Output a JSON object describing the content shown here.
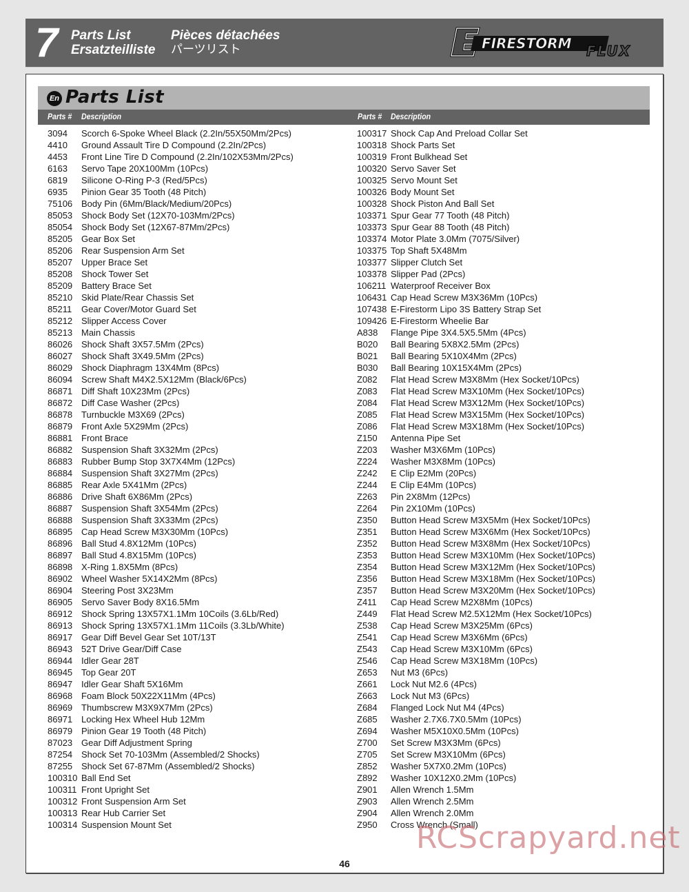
{
  "header": {
    "chapter_number": "7",
    "title_en": "Parts List",
    "title_fr": "Pièces détachées",
    "title_de": "Ersatzteilliste",
    "title_jp": "パーツリスト",
    "logo_text_main": "FIRESTORM",
    "logo_text_sub": "FLUX",
    "logo_letter": "E"
  },
  "section": {
    "language_badge": "En",
    "title": "Parts List"
  },
  "columns": {
    "parts_num": "Parts #",
    "description": "Description"
  },
  "parts_left": [
    {
      "num": "3094",
      "desc": "Scorch 6-Spoke Wheel Black (2.2In/55X50Mm/2Pcs)"
    },
    {
      "num": "4410",
      "desc": "Ground Assault Tire D Compound (2.2In/2Pcs)"
    },
    {
      "num": "4453",
      "desc": "Front Line Tire D Compound (2.2In/102X53Mm/2Pcs)"
    },
    {
      "num": "6163",
      "desc": "Servo Tape 20X100Mm (10Pcs)"
    },
    {
      "num": "6819",
      "desc": "Silicone O-Ring P-3 (Red/5Pcs)"
    },
    {
      "num": "6935",
      "desc": "Pinion Gear 35 Tooth (48 Pitch)"
    },
    {
      "num": "75106",
      "desc": "Body Pin (6Mm/Black/Medium/20Pcs)"
    },
    {
      "num": "85053",
      "desc": "Shock Body Set (12X70-103Mm/2Pcs)"
    },
    {
      "num": "85054",
      "desc": "Shock Body Set (12X67-87Mm/2Pcs)"
    },
    {
      "num": "85205",
      "desc": "Gear Box Set"
    },
    {
      "num": "85206",
      "desc": "Rear Suspension Arm Set"
    },
    {
      "num": "85207",
      "desc": "Upper Brace Set"
    },
    {
      "num": "85208",
      "desc": "Shock Tower Set"
    },
    {
      "num": "85209",
      "desc": "Battery Brace Set"
    },
    {
      "num": "85210",
      "desc": "Skid Plate/Rear Chassis Set"
    },
    {
      "num": "85211",
      "desc": "Gear Cover/Motor Guard Set"
    },
    {
      "num": "85212",
      "desc": "Slipper Access Cover"
    },
    {
      "num": "85213",
      "desc": "Main Chassis"
    },
    {
      "num": "86026",
      "desc": "Shock Shaft 3X57.5Mm (2Pcs)"
    },
    {
      "num": "86027",
      "desc": "Shock Shaft 3X49.5Mm (2Pcs)"
    },
    {
      "num": "86029",
      "desc": "Shock Diaphragm 13X4Mm (8Pcs)"
    },
    {
      "num": "86094",
      "desc": "Screw Shaft M4X2.5X12Mm (Black/6Pcs)"
    },
    {
      "num": "86871",
      "desc": "Diff Shaft 10X23Mm (2Pcs)"
    },
    {
      "num": "86872",
      "desc": "Diff Case Washer (2Pcs)"
    },
    {
      "num": "86878",
      "desc": "Turnbuckle M3X69 (2Pcs)"
    },
    {
      "num": "86879",
      "desc": "Front Axle 5X29Mm (2Pcs)"
    },
    {
      "num": "86881",
      "desc": "Front Brace"
    },
    {
      "num": "86882",
      "desc": "Suspension Shaft 3X32Mm (2Pcs)"
    },
    {
      "num": "86883",
      "desc": "Rubber Bump Stop 3X7X4Mm (12Pcs)"
    },
    {
      "num": "86884",
      "desc": "Suspension Shaft 3X27Mm (2Pcs)"
    },
    {
      "num": "86885",
      "desc": "Rear Axle 5X41Mm (2Pcs)"
    },
    {
      "num": "86886",
      "desc": "Drive Shaft 6X86Mm (2Pcs)"
    },
    {
      "num": "86887",
      "desc": "Suspension Shaft 3X54Mm (2Pcs)"
    },
    {
      "num": "86888",
      "desc": "Suspension Shaft 3X33Mm (2Pcs)"
    },
    {
      "num": "86895",
      "desc": "Cap Head Screw M3X30Mm (10Pcs)"
    },
    {
      "num": "86896",
      "desc": "Ball Stud 4.8X12Mm (10Pcs)"
    },
    {
      "num": "86897",
      "desc": "Ball Stud 4.8X15Mm (10Pcs)"
    },
    {
      "num": "86898",
      "desc": "X-Ring 1.8X5Mm (8Pcs)"
    },
    {
      "num": "86902",
      "desc": "Wheel Washer 5X14X2Mm (8Pcs)"
    },
    {
      "num": "86904",
      "desc": "Steering Post 3X23Mm"
    },
    {
      "num": "86905",
      "desc": "Servo Saver Body 8X16.5Mm"
    },
    {
      "num": "86912",
      "desc": "Shock Spring 13X57X1.1Mm 10Coils (3.6Lb/Red)"
    },
    {
      "num": "86913",
      "desc": "Shock Spring 13X57X1.1Mm 11Coils (3.3Lb/White)"
    },
    {
      "num": "86917",
      "desc": "Gear Diff Bevel Gear Set 10T/13T"
    },
    {
      "num": "86943",
      "desc": "52T Drive Gear/Diff Case"
    },
    {
      "num": "86944",
      "desc": "Idler Gear 28T"
    },
    {
      "num": "86945",
      "desc": "Top Gear 20T"
    },
    {
      "num": "86947",
      "desc": "Idler Gear Shaft 5X16Mm"
    },
    {
      "num": "86968",
      "desc": "Foam Block 50X22X11Mm (4Pcs)"
    },
    {
      "num": "86969",
      "desc": "Thumbscrew M3X9X7Mm (2Pcs)"
    },
    {
      "num": "86971",
      "desc": "Locking Hex Wheel Hub 12Mm"
    },
    {
      "num": "86979",
      "desc": "Pinion Gear 19 Tooth (48 Pitch)"
    },
    {
      "num": "87023",
      "desc": "Gear Diff Adjustment Spring"
    },
    {
      "num": "87254",
      "desc": "Shock Set 70-103Mm (Assembled/2 Shocks)"
    },
    {
      "num": "87255",
      "desc": "Shock Set 67-87Mm (Assembled/2 Shocks)"
    },
    {
      "num": "100310",
      "desc": "Ball End Set"
    },
    {
      "num": "100311",
      "desc": "Front Upright Set"
    },
    {
      "num": "100312",
      "desc": "Front Suspension Arm Set"
    },
    {
      "num": "100313",
      "desc": "Rear Hub Carrier Set"
    },
    {
      "num": "100314",
      "desc": "Suspension Mount Set"
    }
  ],
  "parts_right": [
    {
      "num": "100317",
      "desc": "Shock Cap And Preload Collar Set"
    },
    {
      "num": "100318",
      "desc": "Shock Parts Set"
    },
    {
      "num": "100319",
      "desc": "Front Bulkhead Set"
    },
    {
      "num": "100320",
      "desc": "Servo Saver Set"
    },
    {
      "num": "100325",
      "desc": "Servo Mount Set"
    },
    {
      "num": "100326",
      "desc": "Body Mount Set"
    },
    {
      "num": "100328",
      "desc": "Shock Piston And Ball Set"
    },
    {
      "num": "103371",
      "desc": "Spur Gear 77 Tooth (48 Pitch)"
    },
    {
      "num": "103373",
      "desc": "Spur Gear 88 Tooth (48 Pitch)"
    },
    {
      "num": "103374",
      "desc": "Motor Plate 3.0Mm (7075/Silver)"
    },
    {
      "num": "103375",
      "desc": "Top Shaft 5X48Mm"
    },
    {
      "num": "103377",
      "desc": "Slipper Clutch Set"
    },
    {
      "num": "103378",
      "desc": "Slipper Pad (2Pcs)"
    },
    {
      "num": "106211",
      "desc": "Waterproof Receiver Box"
    },
    {
      "num": "106431",
      "desc": "Cap Head Screw M3X36Mm (10Pcs)"
    },
    {
      "num": "107438",
      "desc": "E-Firestorm Lipo 3S Battery Strap Set"
    },
    {
      "num": "109426",
      "desc": "E-Firestorm Wheelie Bar"
    },
    {
      "num": "A838",
      "desc": "Flange Pipe 3X4.5X5.5Mm (4Pcs)"
    },
    {
      "num": "B020",
      "desc": "Ball Bearing 5X8X2.5Mm (2Pcs)"
    },
    {
      "num": "B021",
      "desc": "Ball Bearing 5X10X4Mm (2Pcs)"
    },
    {
      "num": "B030",
      "desc": "Ball Bearing 10X15X4Mm (2Pcs)"
    },
    {
      "num": "Z082",
      "desc": "Flat Head Screw M3X8Mm (Hex Socket/10Pcs)"
    },
    {
      "num": "Z083",
      "desc": "Flat Head Screw M3X10Mm (Hex Socket/10Pcs)"
    },
    {
      "num": "Z084",
      "desc": "Flat Head Screw M3X12Mm (Hex Socket/10Pcs)"
    },
    {
      "num": "Z085",
      "desc": "Flat Head Screw M3X15Mm (Hex Socket/10Pcs)"
    },
    {
      "num": "Z086",
      "desc": "Flat Head Screw M3X18Mm (Hex Socket/10Pcs)"
    },
    {
      "num": "Z150",
      "desc": "Antenna Pipe Set"
    },
    {
      "num": "Z203",
      "desc": "Washer M3X6Mm (10Pcs)"
    },
    {
      "num": "Z224",
      "desc": "Washer M3X8Mm (10Pcs)"
    },
    {
      "num": "Z242",
      "desc": "E Clip E2Mm (20Pcs)"
    },
    {
      "num": "Z244",
      "desc": "E Clip E4Mm (10Pcs)"
    },
    {
      "num": "Z263",
      "desc": "Pin 2X8Mm (12Pcs)"
    },
    {
      "num": "Z264",
      "desc": "Pin 2X10Mm (10Pcs)"
    },
    {
      "num": "Z350",
      "desc": "Button Head Screw M3X5Mm (Hex Socket/10Pcs)"
    },
    {
      "num": "Z351",
      "desc": "Button Head Screw M3X6Mm (Hex Socket/10Pcs)"
    },
    {
      "num": "Z352",
      "desc": "Button Head Screw M3X8Mm (Hex Socket/10Pcs)"
    },
    {
      "num": "Z353",
      "desc": "Button Head Screw M3X10Mm (Hex Socket/10Pcs)"
    },
    {
      "num": "Z354",
      "desc": "Button Head Screw M3X12Mm (Hex Socket/10Pcs)"
    },
    {
      "num": "Z356",
      "desc": "Button Head Screw M3X18Mm (Hex Socket/10Pcs)"
    },
    {
      "num": "Z357",
      "desc": "Button Head Screw M3X20Mm (Hex Socket/10Pcs)"
    },
    {
      "num": "Z411",
      "desc": "Cap Head Screw M2X8Mm (10Pcs)"
    },
    {
      "num": "Z449",
      "desc": "Flat Head Screw M2.5X12Mm (Hex Socket/10Pcs)"
    },
    {
      "num": "Z538",
      "desc": "Cap Head Screw M3X25Mm (6Pcs)"
    },
    {
      "num": "Z541",
      "desc": "Cap Head Screw M3X6Mm (6Pcs)"
    },
    {
      "num": "Z543",
      "desc": "Cap Head Screw M3X10Mm (6Pcs)"
    },
    {
      "num": "Z546",
      "desc": "Cap Head Screw M3X18Mm (10Pcs)"
    },
    {
      "num": "Z653",
      "desc": "Nut M3 (6Pcs)"
    },
    {
      "num": "Z661",
      "desc": "Lock Nut M2.6 (4Pcs)"
    },
    {
      "num": "Z663",
      "desc": "Lock Nut M3 (6Pcs)"
    },
    {
      "num": "Z684",
      "desc": "Flanged Lock Nut M4 (4Pcs)"
    },
    {
      "num": "Z685",
      "desc": "Washer 2.7X6.7X0.5Mm (10Pcs)"
    },
    {
      "num": "Z694",
      "desc": "Washer M5X10X0.5Mm (10Pcs)"
    },
    {
      "num": "Z700",
      "desc": "Set Screw M3X3Mm (6Pcs)"
    },
    {
      "num": "Z705",
      "desc": "Set Screw M3X10Mm (6Pcs)"
    },
    {
      "num": "Z852",
      "desc": "Washer 5X7X0.2Mm (10Pcs)"
    },
    {
      "num": "Z892",
      "desc": "Washer 10X12X0.2Mm (10Pcs)"
    },
    {
      "num": "Z901",
      "desc": "Allen Wrench 1.5Mm"
    },
    {
      "num": "Z903",
      "desc": "Allen Wrench 2.5Mm"
    },
    {
      "num": "Z904",
      "desc": "Allen Wrench 2.0Mm"
    },
    {
      "num": "Z950",
      "desc": "Cross Wrench (Small)"
    }
  ],
  "footer": {
    "page_number": "46"
  },
  "watermark": "RCScrapyard.net"
}
